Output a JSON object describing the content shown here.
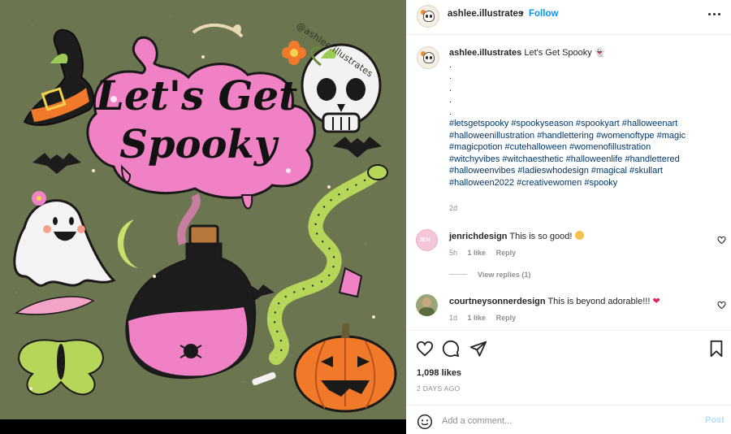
{
  "artwork": {
    "title_line1": "Let's Get",
    "title_line2": "Spooky",
    "watermark": "@ashlee.illustrates"
  },
  "header": {
    "username": "ashlee.illustrates",
    "separator": "•",
    "follow_label": "Follow"
  },
  "caption": {
    "username": "ashlee.illustrates",
    "text": "Let's Get Spooky",
    "emoji": "👻",
    "dots": [
      ".",
      ".",
      ".",
      ".",
      "."
    ],
    "hashtags_line1": "#letsgetspooky #spookyseason #spookyart #halloweenart",
    "hashtags_line2": "#halloweenillustration #handlettering #womenoftype #magic",
    "hashtags_line3": "#magicpotion #cutehalloween #womenofillustration",
    "hashtags_line4": "#witchyvibes #witchaesthetic #halloweenlife #handlettered",
    "hashtags_line5": "#halloweenvibes #ladieswhodesign #magical #skullart",
    "hashtags_line6": "#halloween2022 #creativewomen #spooky",
    "time": "2d"
  },
  "comments": [
    {
      "username": "jenrichdesign",
      "text": "This is so good!",
      "time": "5h",
      "likes": "1 like",
      "reply": "Reply",
      "avatar_text": "JEN"
    },
    {
      "username": "courtneysonnerdesign",
      "text": "This is beyond adorable!!!",
      "time": "1d",
      "likes": "1 like",
      "reply": "Reply"
    }
  ],
  "view_replies": "View replies (1)",
  "likes_count": "1,098 likes",
  "post_date": "2 DAYS AGO",
  "add_comment": {
    "placeholder": "Add a comment...",
    "post_label": "Post"
  },
  "colors": {
    "link_blue": "#0095f6",
    "hashtag_blue": "#00376b",
    "muted_gray": "#8e8e8e",
    "artwork_bg": "#6b7550",
    "accent_pink": "#f081c4"
  },
  "icons": [
    "more-icon",
    "heart-icon",
    "comment-icon",
    "share-icon",
    "bookmark-icon",
    "smile-icon"
  ]
}
